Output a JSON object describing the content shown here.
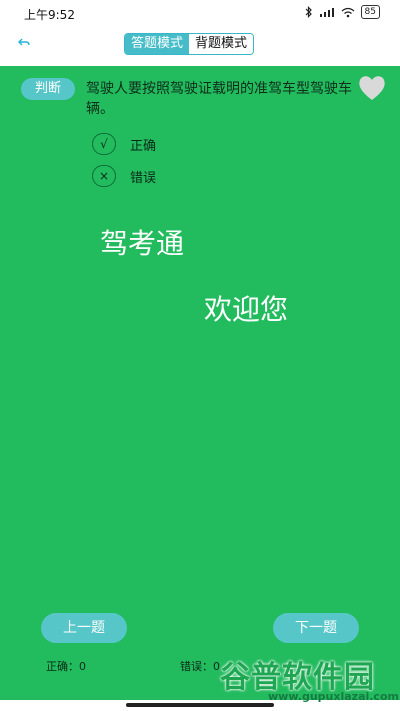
{
  "status_bar": {
    "time": "上午9:52",
    "battery": "85"
  },
  "header": {
    "modes": [
      {
        "label": "答题模式",
        "active": true
      },
      {
        "label": "背题模式",
        "active": false
      }
    ]
  },
  "question": {
    "type": "判断",
    "text": "驾驶人要按照驾驶证载明的准驾车型驾驶车辆。",
    "options": [
      {
        "mark": "√",
        "label": "正确"
      },
      {
        "mark": "×",
        "label": "错误"
      }
    ]
  },
  "welcome": {
    "line1": "驾考通",
    "line2": "欢迎您"
  },
  "nav": {
    "prev_label": "上一题",
    "next_label": "下一题"
  },
  "score": {
    "correct": "正确：0",
    "wrong": "错误：0"
  },
  "watermark": {
    "title": "谷普软件园",
    "url": "www.gupuxlazai.com"
  },
  "colors": {
    "main_bg": "#22bb5e",
    "accent": "#57c6c8",
    "heart": "#d9d9d9"
  }
}
